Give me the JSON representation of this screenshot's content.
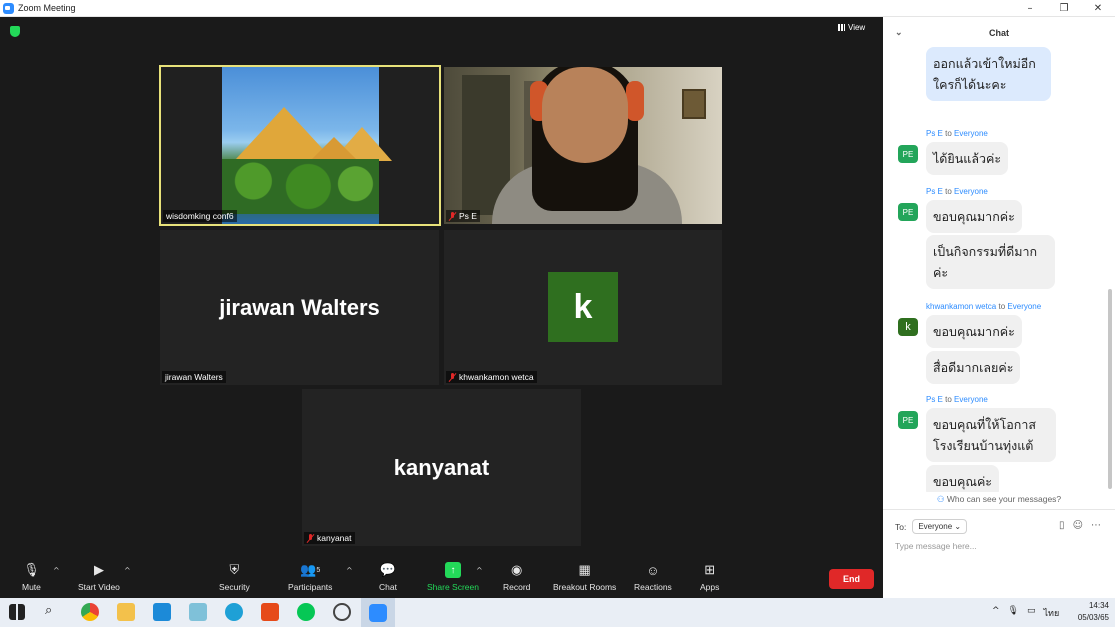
{
  "window": {
    "title": "Zoom Meeting",
    "controls": [
      "–",
      "❐",
      "✕"
    ]
  },
  "meeting": {
    "view_label": "View",
    "tiles": [
      {
        "name": "wisdomking conf6",
        "muted": false
      },
      {
        "name": "Ps E",
        "muted": true
      },
      {
        "name": "jirawan Walters",
        "display": "jirawan Walters",
        "muted": false
      },
      {
        "name": "khwankamon wetca",
        "avatar_letter": "k",
        "muted": true
      },
      {
        "name": "kanyanat",
        "display": "kanyanat",
        "muted": true
      }
    ]
  },
  "toolbar": {
    "mute": "Mute",
    "start_video": "Start Video",
    "security": "Security",
    "participants": "Participants",
    "participants_count": "5",
    "chat": "Chat",
    "share_screen": "Share Screen",
    "record": "Record",
    "breakout_rooms": "Breakout Rooms",
    "reactions": "Reactions",
    "apps": "Apps",
    "end": "End"
  },
  "chat": {
    "title": "Chat",
    "own_message": "ออกแล้วเข้าใหม่อีกใครก็ได้นะคะ",
    "groups": [
      {
        "sender": "Ps E",
        "to_word": "to",
        "recipient": "Everyone",
        "avatar": "PE",
        "messages": [
          "ได้ยินแล้วค่ะ"
        ]
      },
      {
        "sender": "Ps E",
        "to_word": "to",
        "recipient": "Everyone",
        "avatar": "PE",
        "messages": [
          "ขอบคุณมากค่ะ",
          "เป็นกิจกรรมที่ดีมากค่ะ"
        ]
      },
      {
        "sender": "khwankamon wetca",
        "to_word": "to",
        "recipient": "Everyone",
        "avatar": "k",
        "messages": [
          "ขอบคุณมากค่ะ",
          "สื่อดีมากเลยค่ะ"
        ]
      },
      {
        "sender": "Ps E",
        "to_word": "to",
        "recipient": "Everyone",
        "avatar": "PE",
        "messages": [
          "ขอบคุณที่ให้โอกาสโรงเรียนบ้านทุ่งแต้",
          "ขอบคุณค่ะ"
        ]
      }
    ],
    "who_can_see": "Who can see your messages?",
    "to_label": "To:",
    "to_value": "Everyone",
    "input_placeholder": "Type message here..."
  },
  "taskbar": {
    "language": "ไทย",
    "time": "14:34",
    "date": "05/03/65"
  }
}
